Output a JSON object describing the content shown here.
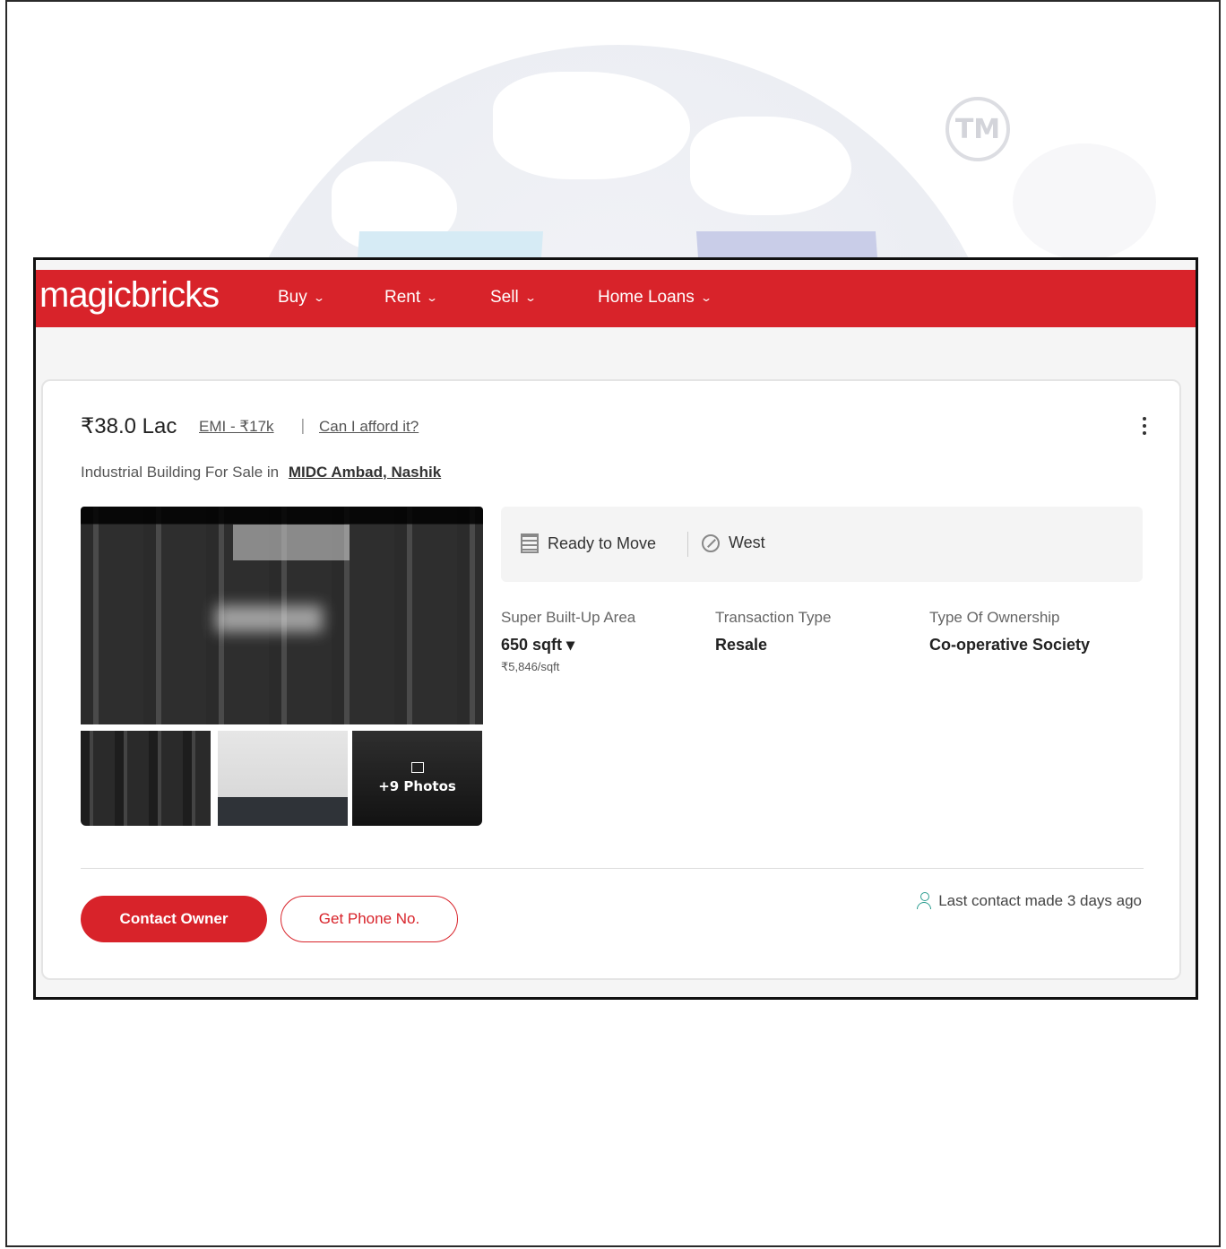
{
  "watermark": {
    "tm": "TM"
  },
  "brand": {
    "logo": "magicbricks",
    "accent": "#d8232a"
  },
  "nav": {
    "items": [
      {
        "label": "Buy"
      },
      {
        "label": "Rent"
      },
      {
        "label": "Sell"
      },
      {
        "label": "Home Loans"
      }
    ]
  },
  "listing": {
    "price": "₹38.0 Lac",
    "emi": "EMI - ₹17k",
    "separator": "|",
    "afford": "Can I afford it?",
    "subtitle": "Industrial Building For Sale in",
    "location": "MIDC Ambad, Nashik",
    "photos_more": "+9 Photos",
    "status": "Ready to Move",
    "facing": "West",
    "specs": [
      {
        "label": "Super Built-Up Area",
        "value": "650 sqft ▾",
        "sub": "₹5,846/sqft"
      },
      {
        "label": "Transaction Type",
        "value": "Resale"
      },
      {
        "label": "Type Of Ownership",
        "value": "Co-operative Society"
      }
    ],
    "contact_button": "Contact Owner",
    "phone_button": "Get Phone No.",
    "last_contact": "Last contact made 3 days ago"
  }
}
